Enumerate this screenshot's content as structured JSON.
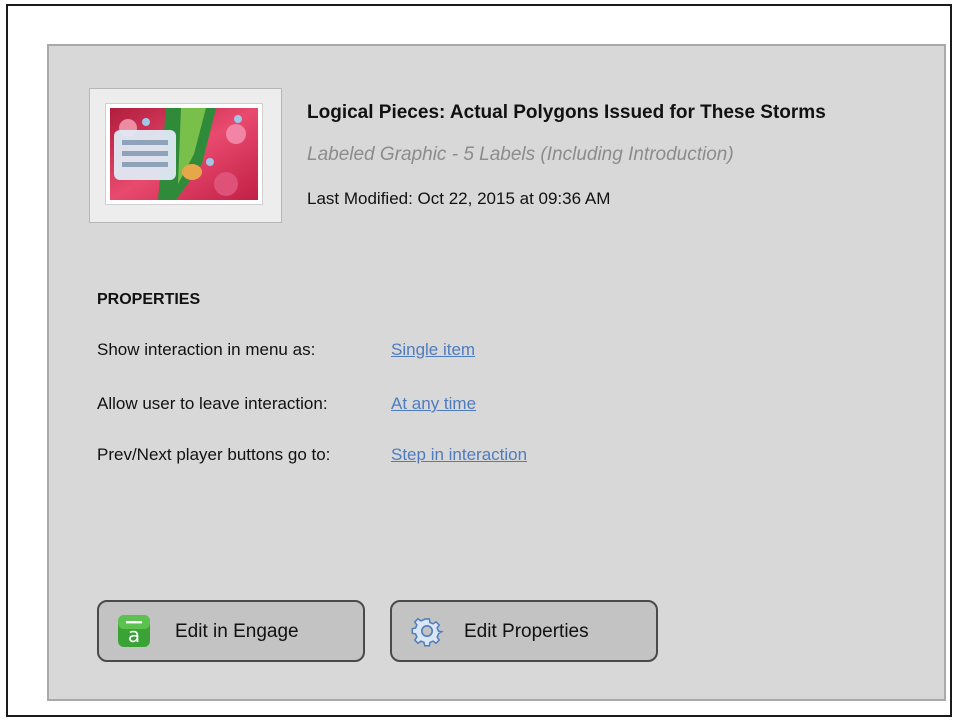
{
  "item": {
    "title": "Logical Pieces: Actual Polygons Issued for These Storms",
    "subtitle": "Labeled Graphic - 5 Labels (Including Introduction)",
    "last_modified": "Last Modified: Oct 22, 2015 at 09:36 AM",
    "thumbnail_icon": "labeled-graphic-thumbnail"
  },
  "properties": {
    "heading": "PROPERTIES",
    "rows": [
      {
        "label": "Show interaction in menu as:",
        "value": "Single item"
      },
      {
        "label": "Allow user to leave interaction:",
        "value": "At any time"
      },
      {
        "label": "Prev/Next player buttons go to:",
        "value": "Step in interaction"
      }
    ]
  },
  "buttons": {
    "engage": {
      "label": "Edit in Engage",
      "icon": "engage-app-icon",
      "icon_color": "#3aa336"
    },
    "properties": {
      "label": "Edit Properties",
      "icon": "gear-icon",
      "icon_color": "#4f7bbf"
    }
  },
  "colors": {
    "panel_bg": "#d8d8d8",
    "link": "#4f7bbf",
    "subtitle": "#8c8c8c"
  }
}
